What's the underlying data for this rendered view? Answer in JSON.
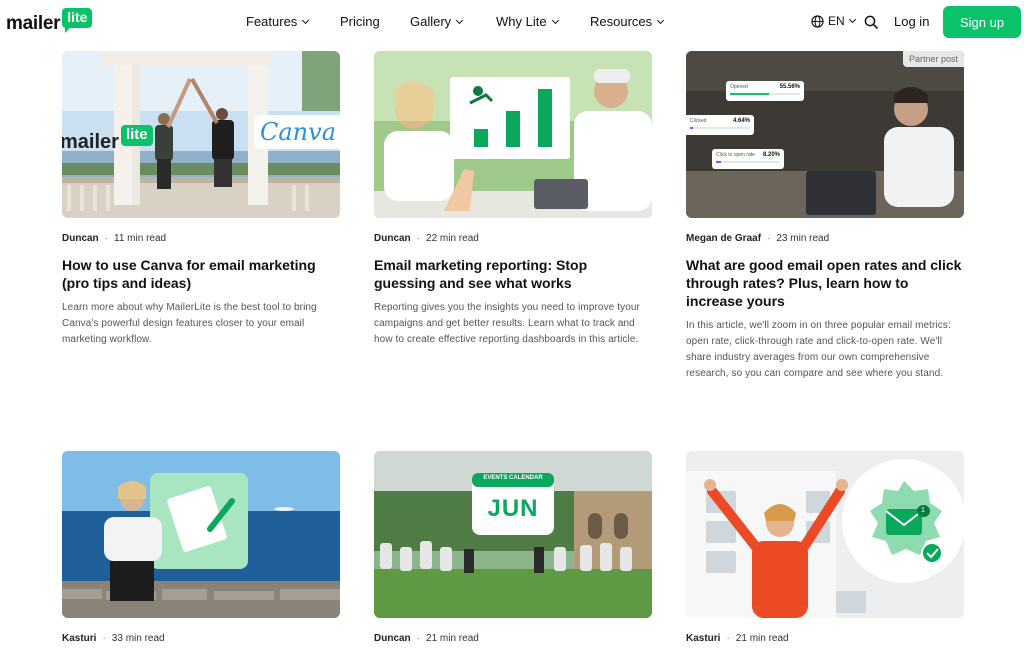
{
  "header": {
    "logo_text": "mailer",
    "logo_badge": "lite",
    "nav": [
      "Features",
      "Pricing",
      "Gallery",
      "Why Lite",
      "Resources"
    ],
    "lang": "EN",
    "login": "Log in",
    "signup": "Sign up"
  },
  "cards": [
    {
      "author": "Duncan",
      "read": "11 min read",
      "title": "How to use Canva for email marketing (pro tips and ideas)",
      "excerpt": "Learn more about why MailerLite is the best tool to bring Canva's powerful design features closer to your email marketing workflow.",
      "thumb": {
        "logo_text": "mailer",
        "logo_badge": "lite",
        "canva": "Canva"
      }
    },
    {
      "author": "Duncan",
      "read": "22 min read",
      "title": "Email marketing reporting: Stop guessing and see what works",
      "excerpt": "Reporting gives you the insights you need to improve tyour campaigns and get better results. Learn what to track and how to create effective reporting dashboards in this article."
    },
    {
      "author": "Megan de Graaf",
      "read": "23 min read",
      "title": "What are good email open rates and click through rates? Plus, learn how to increase yours",
      "excerpt": "In this article, we'll zoom in on three popular email metrics: open rate, click-through rate and click-to-open rate. We'll share industry averages from our own comprehensive research, so you can compare and see where you stand.",
      "thumb": {
        "partner": "Partner post",
        "stats": [
          {
            "label": "Opened",
            "value": "55.56%",
            "fill": 0.56
          },
          {
            "label": "Clicked",
            "value": "4.64%",
            "fill": 0.05
          },
          {
            "label": "Click to open rate",
            "value": "8.20%",
            "fill": 0.08
          }
        ]
      }
    },
    {
      "author": "Kasturi",
      "read": "33 min read"
    },
    {
      "author": "Duncan",
      "read": "21 min read",
      "thumb": {
        "banner": "EVENTS CALENDAR",
        "month": "JUN"
      }
    },
    {
      "author": "Kasturi",
      "read": "21 min read",
      "thumb": {
        "badge_count": "1"
      }
    }
  ],
  "colors": {
    "brand": "#09c269",
    "text": "#111111",
    "muted": "#555555"
  }
}
